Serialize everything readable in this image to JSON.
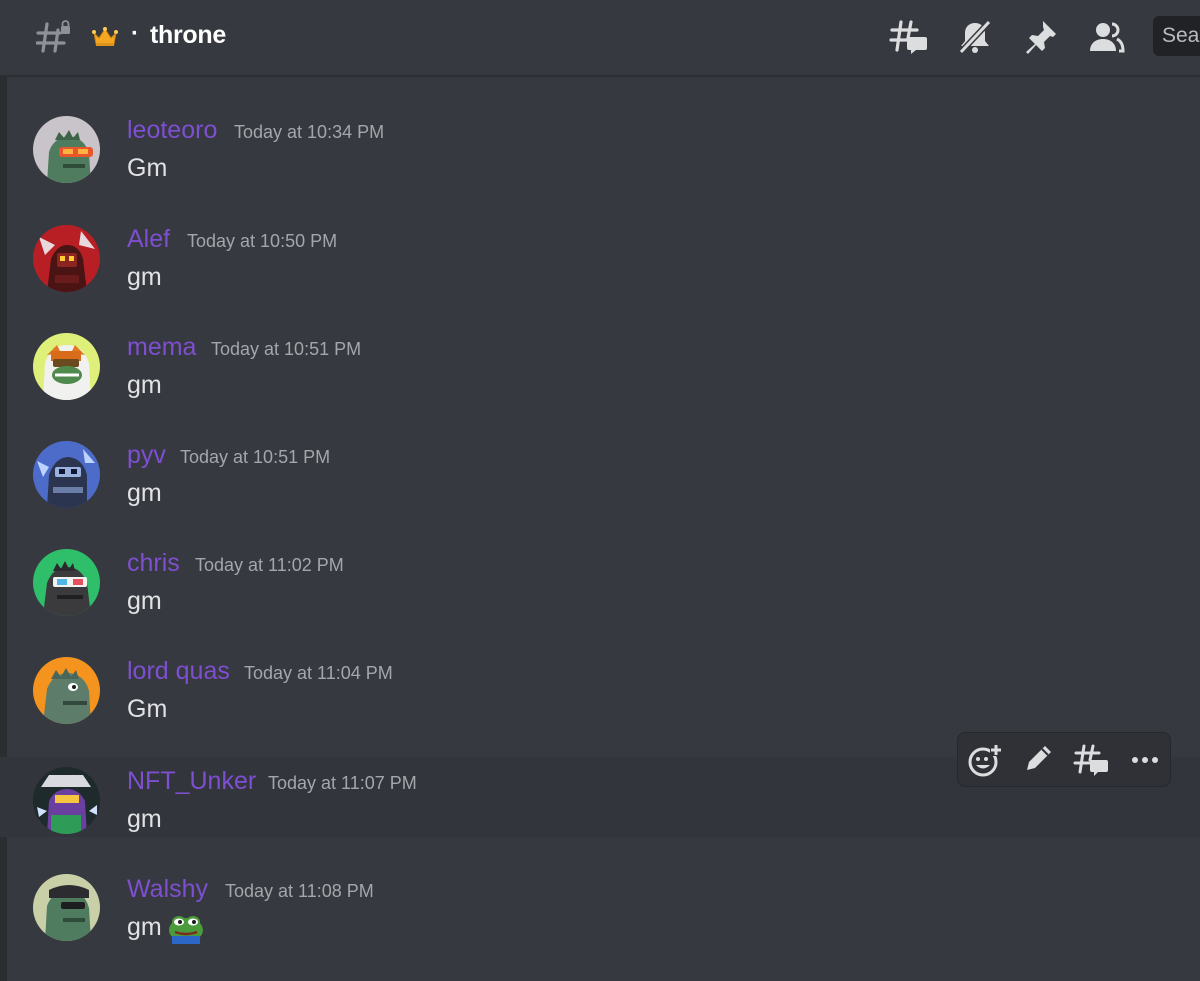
{
  "channel": {
    "name": "throne",
    "separator": "·",
    "thread_icon": "thread-channel-icon",
    "prefix_icon": "crown-icon"
  },
  "header_actions": [
    {
      "icon": "threads-icon"
    },
    {
      "icon": "notifications-muted-icon"
    },
    {
      "icon": "pin-icon"
    },
    {
      "icon": "members-icon"
    }
  ],
  "search": {
    "placeholder": "Search"
  },
  "messages": [
    {
      "username": "leoteoro",
      "timestamp": "Today at 10:34 PM",
      "content": "Gm"
    },
    {
      "username": "Alef",
      "timestamp": "Today at 10:50 PM",
      "content": "gm"
    },
    {
      "username": "mema",
      "timestamp": "Today at 10:51 PM",
      "content": "gm"
    },
    {
      "username": "pyv",
      "timestamp": "Today at 10:51 PM",
      "content": "gm"
    },
    {
      "username": "chris",
      "timestamp": "Today at 11:02 PM",
      "content": "gm"
    },
    {
      "username": "lord quas",
      "timestamp": "Today at 11:04 PM",
      "content": "Gm"
    },
    {
      "username": "NFT_Unker",
      "timestamp": "Today at 11:07 PM",
      "content": "gm"
    },
    {
      "username": "Walshy",
      "timestamp": "Today at 11:08 PM",
      "content": "gm",
      "emoji": "pepe-frog-emoji"
    }
  ],
  "message_toolbar": [
    {
      "icon": "add-reaction-icon"
    },
    {
      "icon": "edit-icon"
    },
    {
      "icon": "create-thread-icon"
    },
    {
      "icon": "more-options-icon"
    }
  ],
  "colors": {
    "background": "#36393f",
    "username": "#7e4fd0",
    "timestamp": "#a3a6aa",
    "text": "#e1e2e4",
    "icon": "#dcddde"
  }
}
